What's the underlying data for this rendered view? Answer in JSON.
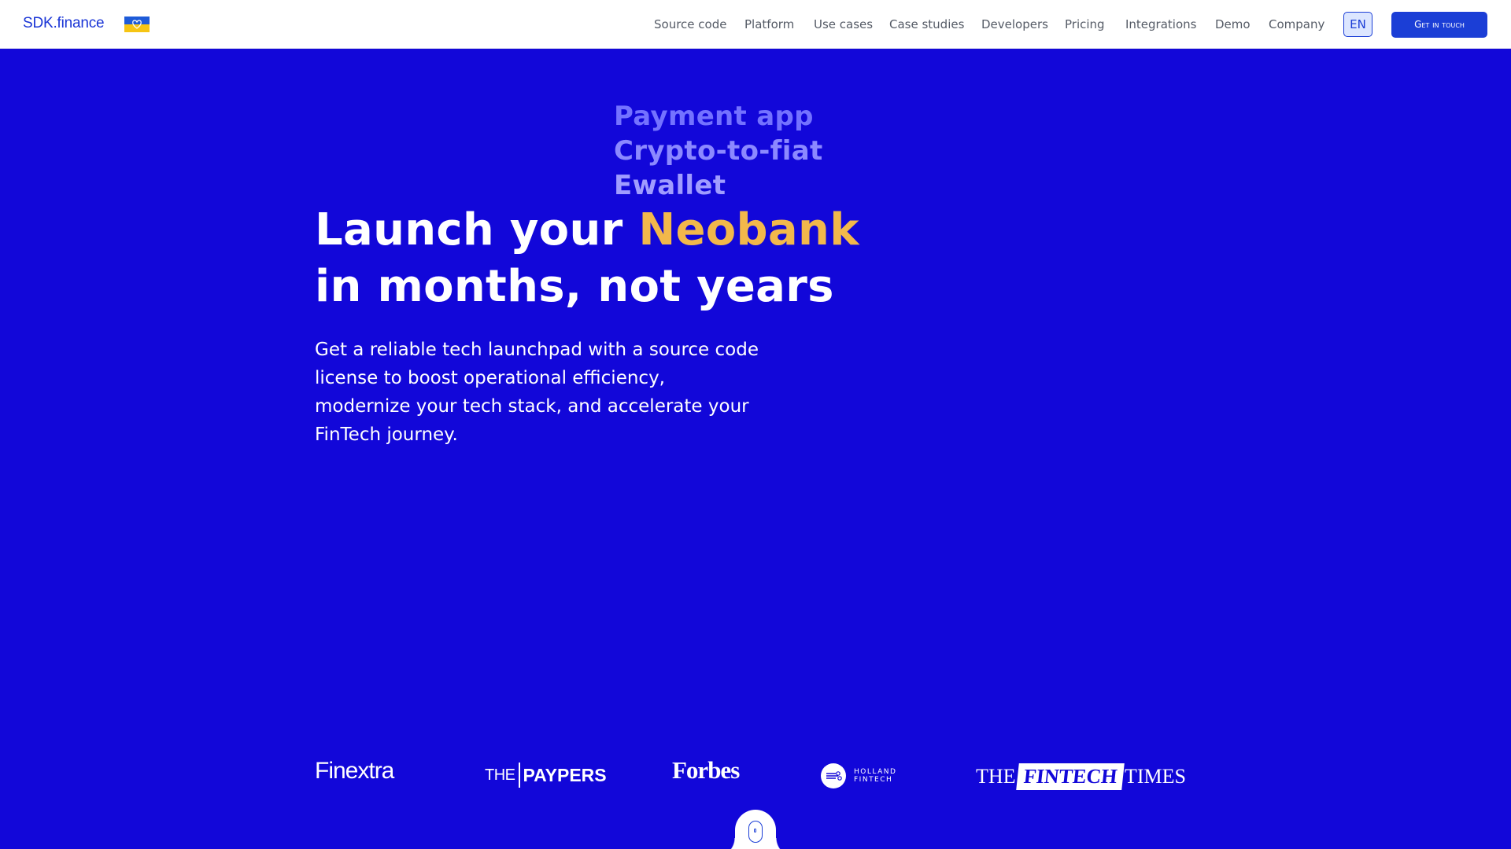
{
  "header": {
    "logo": "SDK.finance",
    "flag_icon": "ukraine-flag-heart-icon",
    "nav": [
      {
        "label": "Source code"
      },
      {
        "label": "Platform"
      },
      {
        "label": "Use cases"
      },
      {
        "label": "Case studies"
      },
      {
        "label": "Developers"
      },
      {
        "label": "Pricing"
      },
      {
        "label": "Integrations"
      },
      {
        "label": "Demo"
      },
      {
        "label": "Company"
      }
    ],
    "language": "EN",
    "cta": "Get in touch"
  },
  "hero": {
    "rotating_words": [
      "Payment app",
      "Crypto-to-fiat",
      "Ewallet"
    ],
    "headline_prefix": "Launch your ",
    "headline_accent": "Neobank",
    "headline_line2": "in months, not years",
    "subheadline": "Get a reliable tech launchpad with a source code license to boost operational efficiency, modernize your tech stack, and accelerate your FinTech journey."
  },
  "press": {
    "finextra": "Finextra",
    "paypers_the": "THE",
    "paypers_name": "PAYPERS",
    "forbes": "Forbes",
    "holland_line1": "HOLLAND",
    "holland_line2": "FINTECH",
    "ftimes_the": "THE",
    "ftimes_fintech": "FINTECH",
    "ftimes_times": "TIMES"
  },
  "colors": {
    "hero_background": "#1207d9",
    "brand_blue": "#1b3ed6",
    "accent_yellow": "#f2b84b",
    "rotating_word": "#7472ff",
    "header_background": "#ffffff"
  },
  "scroll_indicator_icon": "mouse-scroll-icon"
}
